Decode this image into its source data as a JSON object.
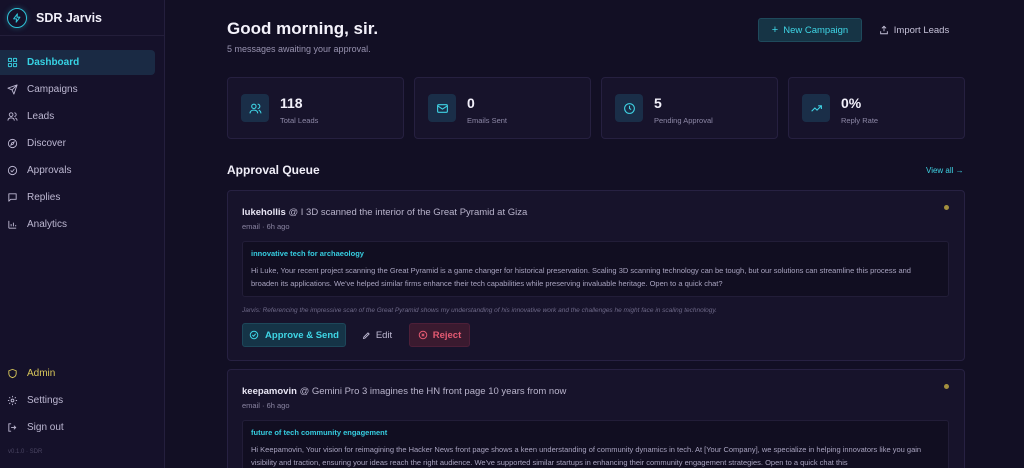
{
  "app": {
    "name": "SDR Jarvis",
    "version": "v0.1.0 · SDR"
  },
  "sidebar": {
    "items": [
      {
        "label": "Dashboard",
        "icon": "grid-icon",
        "active": true
      },
      {
        "label": "Campaigns",
        "icon": "send-icon"
      },
      {
        "label": "Leads",
        "icon": "users-icon"
      },
      {
        "label": "Discover",
        "icon": "compass-icon"
      },
      {
        "label": "Approvals",
        "icon": "check-circle-icon"
      },
      {
        "label": "Replies",
        "icon": "message-icon"
      },
      {
        "label": "Analytics",
        "icon": "bar-chart-icon"
      }
    ],
    "bottom": [
      {
        "label": "Admin",
        "icon": "shield-icon"
      },
      {
        "label": "Settings",
        "icon": "gear-icon"
      },
      {
        "label": "Sign out",
        "icon": "logout-icon"
      }
    ]
  },
  "header": {
    "greeting": "Good morning, sir.",
    "subtitle": "5 messages awaiting your approval.",
    "new_campaign": "New Campaign",
    "import_leads": "Import Leads"
  },
  "stats": [
    {
      "value": "118",
      "label": "Total Leads",
      "icon": "users-icon"
    },
    {
      "value": "0",
      "label": "Emails Sent",
      "icon": "mail-icon"
    },
    {
      "value": "5",
      "label": "Pending Approval",
      "icon": "clock-icon"
    },
    {
      "value": "0%",
      "label": "Reply Rate",
      "icon": "trending-up-icon"
    }
  ],
  "queue": {
    "title": "Approval Queue",
    "view_all": "View all →",
    "items": [
      {
        "user": "lukehollis",
        "post": "@ I 3D scanned the interior of the Great Pyramid at Giza",
        "meta": "email · 6h ago",
        "subject": "innovative tech for archaeology",
        "body": "Hi Luke, Your recent project scanning the Great Pyramid is a game changer for historical preservation. Scaling 3D scanning technology can be tough, but our solutions can streamline this process and broaden its applications. We've helped similar firms enhance their tech capabilities while preserving invaluable heritage. Open to a quick chat?",
        "reasoning": "Jarvis: Referencing the impressive scan of the Great Pyramid shows my understanding of his innovative work and the challenges he might face in scaling technology.",
        "approve": "Approve & Send",
        "edit": "Edit",
        "reject": "Reject"
      },
      {
        "user": "keepamovin",
        "post": "@ Gemini Pro 3 imagines the HN front page 10 years from now",
        "meta": "email · 6h ago",
        "subject": "future of tech community engagement",
        "body": "Hi Keepamovin, Your vision for reimagining the Hacker News front page shows a keen understanding of community dynamics in tech. At [Your Company], we specialize in helping innovators like you gain visibility and traction, ensuring your ideas reach the right audience. We've supported similar startups in enhancing their community engagement strategies. Open to a quick chat this"
      }
    ]
  },
  "colors": {
    "accent": "#37d3e4",
    "background": "#120f24",
    "reject": "#e45a72",
    "admin": "#d9c85a"
  }
}
